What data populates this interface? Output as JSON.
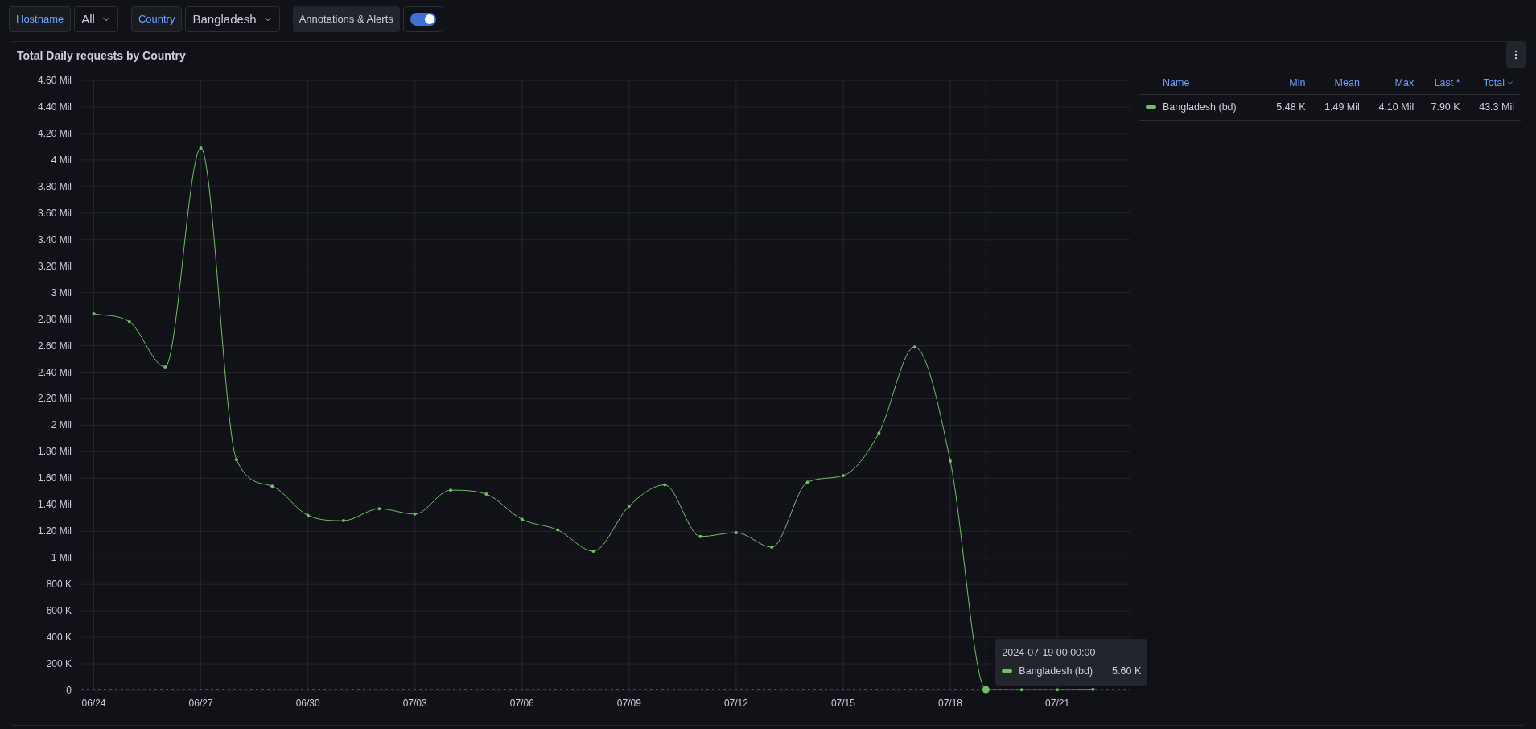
{
  "variables": [
    {
      "label": "Hostname",
      "value": "All"
    },
    {
      "label": "Country",
      "value": "Bangladesh"
    }
  ],
  "toggle": {
    "label": "Annotations & Alerts",
    "on": true
  },
  "panel": {
    "title": "Total Daily requests by Country",
    "legend": {
      "columns": [
        {
          "label": "Name",
          "sorted": false
        },
        {
          "label": "Min",
          "sorted": false
        },
        {
          "label": "Mean",
          "sorted": false
        },
        {
          "label": "Max",
          "sorted": false
        },
        {
          "label": "Last *",
          "sorted": false
        },
        {
          "label": "Total",
          "sorted": true
        }
      ],
      "rows": [
        {
          "color": "#73bf69",
          "cells": [
            "Bangladesh (bd)",
            "5.48 K",
            "1.49 Mil",
            "4.10 Mil",
            "7.90 K",
            "43.3 Mil"
          ]
        }
      ]
    },
    "tooltip": {
      "time": "2024-07-19 00:00:00",
      "value": "5.60 K"
    },
    "chart_data": {
      "type": "line",
      "categories": [
        "06/24",
        null,
        null,
        "06/27",
        null,
        null,
        "06/30",
        null,
        null,
        "07/03",
        null,
        null,
        "07/06",
        null,
        null,
        "07/09",
        null,
        null,
        "07/12",
        null,
        null,
        "07/15",
        null,
        null,
        "07/18",
        null,
        null,
        "07/21",
        null
      ],
      "grid": true,
      "series": [
        {
          "name": "Bangladesh (bd)",
          "color": "#73bf69",
          "values": [
            2.84,
            2.78,
            2.44,
            4.09,
            1.74,
            1.54,
            1.32,
            1.28,
            1.37,
            1.33,
            1.51,
            1.48,
            1.29,
            1.21,
            1.05,
            1.39,
            1.55,
            1.16,
            1.19,
            1.08,
            1.57,
            1.62,
            1.94,
            2.59,
            1.73,
            0.0056,
            0.005,
            0.005,
            0.0079
          ]
        }
      ],
      "ylim": [
        0,
        4.6
      ],
      "yticks": [
        {
          "value": 0,
          "label": "0"
        },
        {
          "value": 0.2,
          "label": "200 K"
        },
        {
          "value": 0.4,
          "label": "400 K"
        },
        {
          "value": 0.6,
          "label": "600 K"
        },
        {
          "value": 0.8,
          "label": "800 K"
        },
        {
          "value": 1,
          "label": "1 Mil"
        },
        {
          "value": 1.2,
          "label": "1.20 Mil"
        },
        {
          "value": 1.4,
          "label": "1.40 Mil"
        },
        {
          "value": 1.6,
          "label": "1.60 Mil"
        },
        {
          "value": 1.8,
          "label": "1.80 Mil"
        },
        {
          "value": 2,
          "label": "2 Mil"
        },
        {
          "value": 2.2,
          "label": "2.20 Mil"
        },
        {
          "value": 2.4,
          "label": "2.40 Mil"
        },
        {
          "value": 2.6,
          "label": "2.60 Mil"
        },
        {
          "value": 2.8,
          "label": "2.80 Mil"
        },
        {
          "value": 3,
          "label": "3 Mil"
        },
        {
          "value": 3.2,
          "label": "3.20 Mil"
        },
        {
          "value": 3.4,
          "label": "3.40 Mil"
        },
        {
          "value": 3.6,
          "label": "3.60 Mil"
        },
        {
          "value": 3.8,
          "label": "3.80 Mil"
        },
        {
          "value": 4,
          "label": "4 Mil"
        },
        {
          "value": 4.2,
          "label": "4.20 Mil"
        },
        {
          "value": 4.4,
          "label": "4.40 Mil"
        },
        {
          "value": 4.6,
          "label": "4.60 Mil"
        }
      ]
    }
  }
}
